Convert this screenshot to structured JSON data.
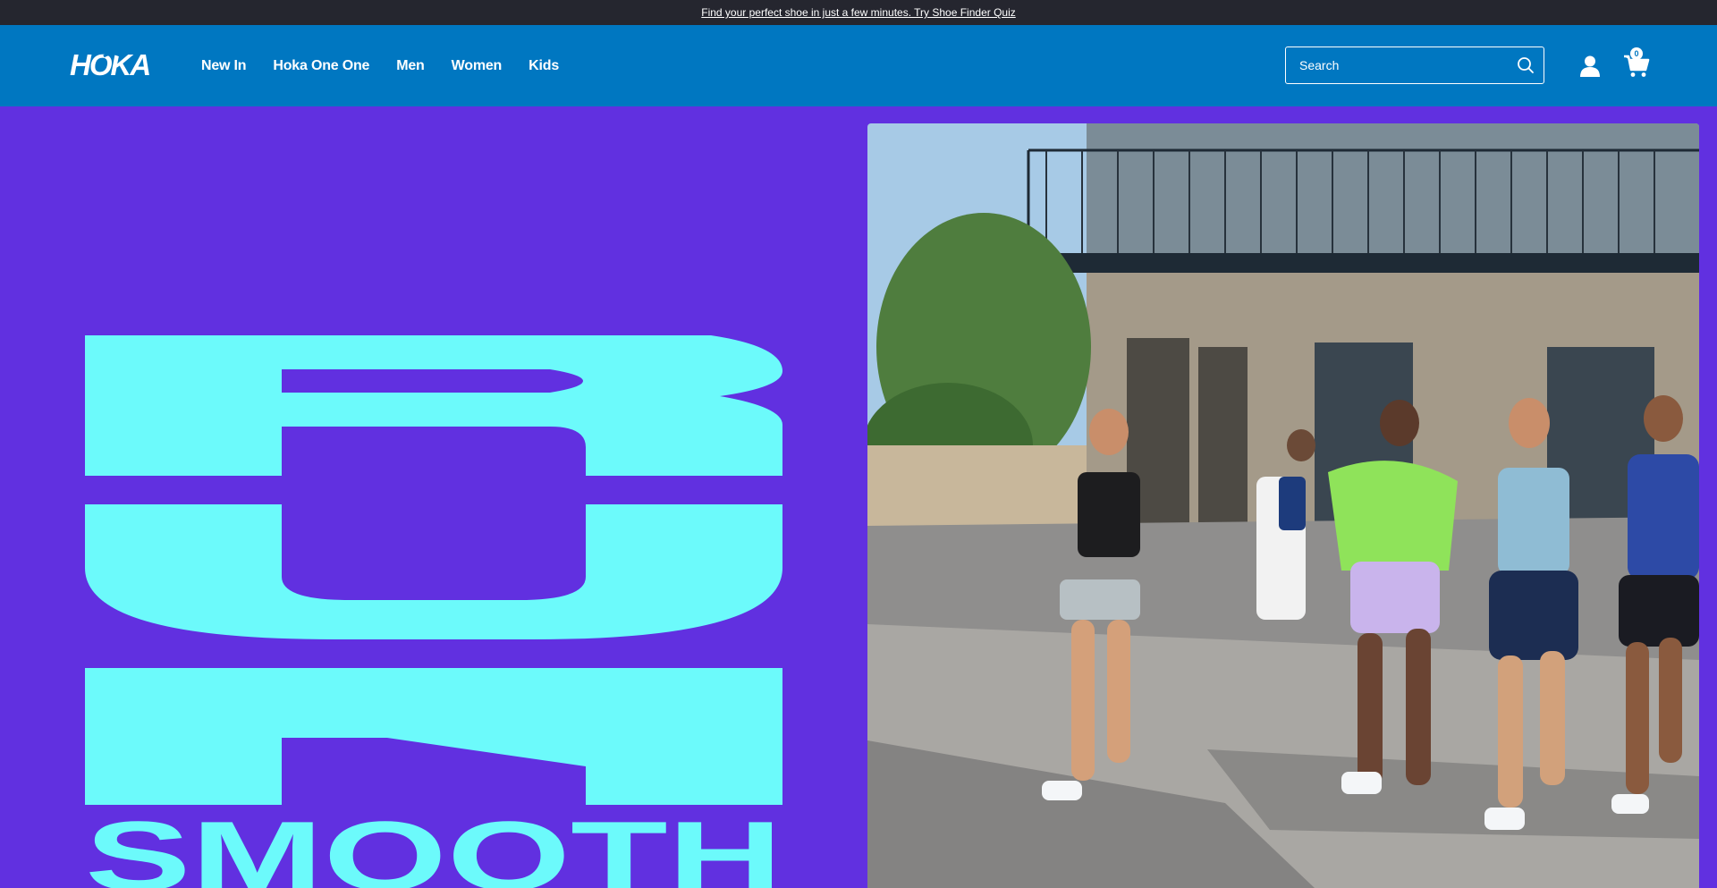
{
  "announcement": {
    "text": "Find your perfect shoe in just a few minutes. Try Shoe Finder Quiz"
  },
  "header": {
    "logo_text": "HOKA",
    "nav": [
      {
        "label": "New In"
      },
      {
        "label": "Hoka One One"
      },
      {
        "label": "Men"
      },
      {
        "label": "Women"
      },
      {
        "label": "Kids"
      }
    ],
    "search_placeholder": "Search",
    "cart_count": "0",
    "icons": {
      "search": "search-icon",
      "account": "user-icon",
      "cart": "cart-icon"
    }
  },
  "hero": {
    "headline_graphic_text": "BON SMOOTH",
    "photo_description_icon": "runners-photo"
  },
  "colors": {
    "announcement_bg": "#25262f",
    "header_bg": "#0077c1",
    "hero_bg": "#6130e0",
    "hero_type": "#6cfafb"
  }
}
